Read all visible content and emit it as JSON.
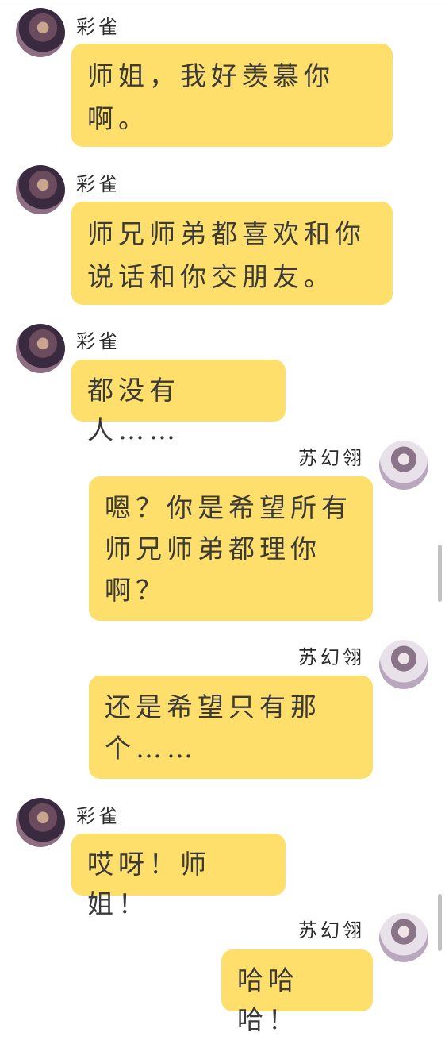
{
  "messages": [
    {
      "side": "left",
      "sender": "彩雀",
      "text": "师姐，我好羡慕你啊。"
    },
    {
      "side": "left",
      "sender": "彩雀",
      "text": "师兄师弟都喜欢和你说话和你交朋友。"
    },
    {
      "side": "left",
      "sender": "彩雀",
      "text": "都没有人……"
    },
    {
      "side": "right",
      "sender": "苏幻翎",
      "text": "嗯？你是希望所有师兄师弟都理你啊？"
    },
    {
      "side": "right",
      "sender": "苏幻翎",
      "text": "还是希望只有那个……"
    },
    {
      "side": "left",
      "sender": "彩雀",
      "text": "哎呀！师姐！"
    },
    {
      "side": "right",
      "sender": "苏幻翎",
      "text": "哈哈哈！"
    }
  ],
  "colors": {
    "bubble": "#ffdf6b",
    "text": "#3a3a3a",
    "scrollbar": "#c2c2c2"
  }
}
